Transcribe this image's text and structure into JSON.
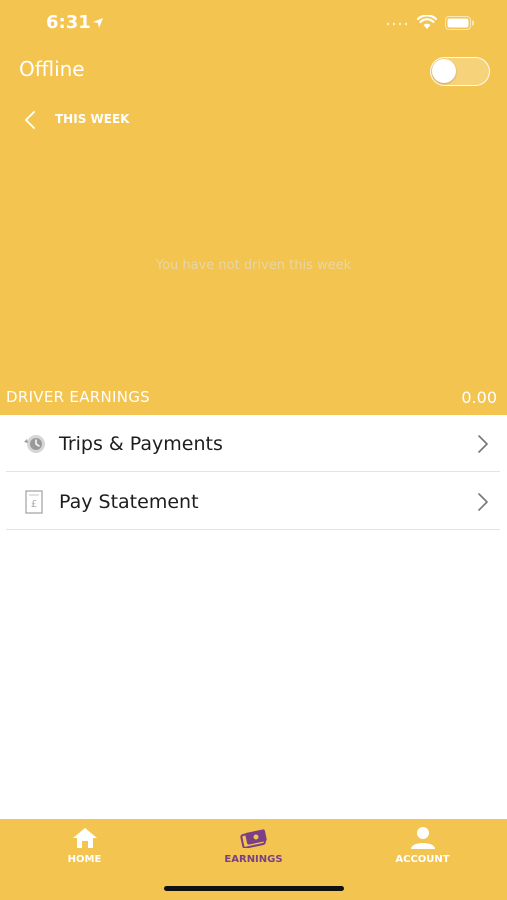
{
  "status_bar": {
    "time": "6:31"
  },
  "header": {
    "status_label": "Offline",
    "toggle_on": false,
    "period_label": "THIS WEEK",
    "empty_message": "You have not driven this week"
  },
  "earnings": {
    "label": "DRIVER EARNINGS",
    "value": "0.00"
  },
  "menu": [
    {
      "label": "Trips & Payments",
      "icon": "history-clock-icon"
    },
    {
      "label": "Pay Statement",
      "icon": "statement-document-icon"
    }
  ],
  "tabs": [
    {
      "label": "HOME",
      "icon": "home-icon",
      "active": false
    },
    {
      "label": "EARNINGS",
      "icon": "money-icon",
      "active": true
    },
    {
      "label": "ACCOUNT",
      "icon": "person-icon",
      "active": false
    }
  ],
  "colors": {
    "header_bg": "#F3C44F",
    "active_tab": "#7a3f85",
    "text_dark": "#1d1d1d"
  }
}
